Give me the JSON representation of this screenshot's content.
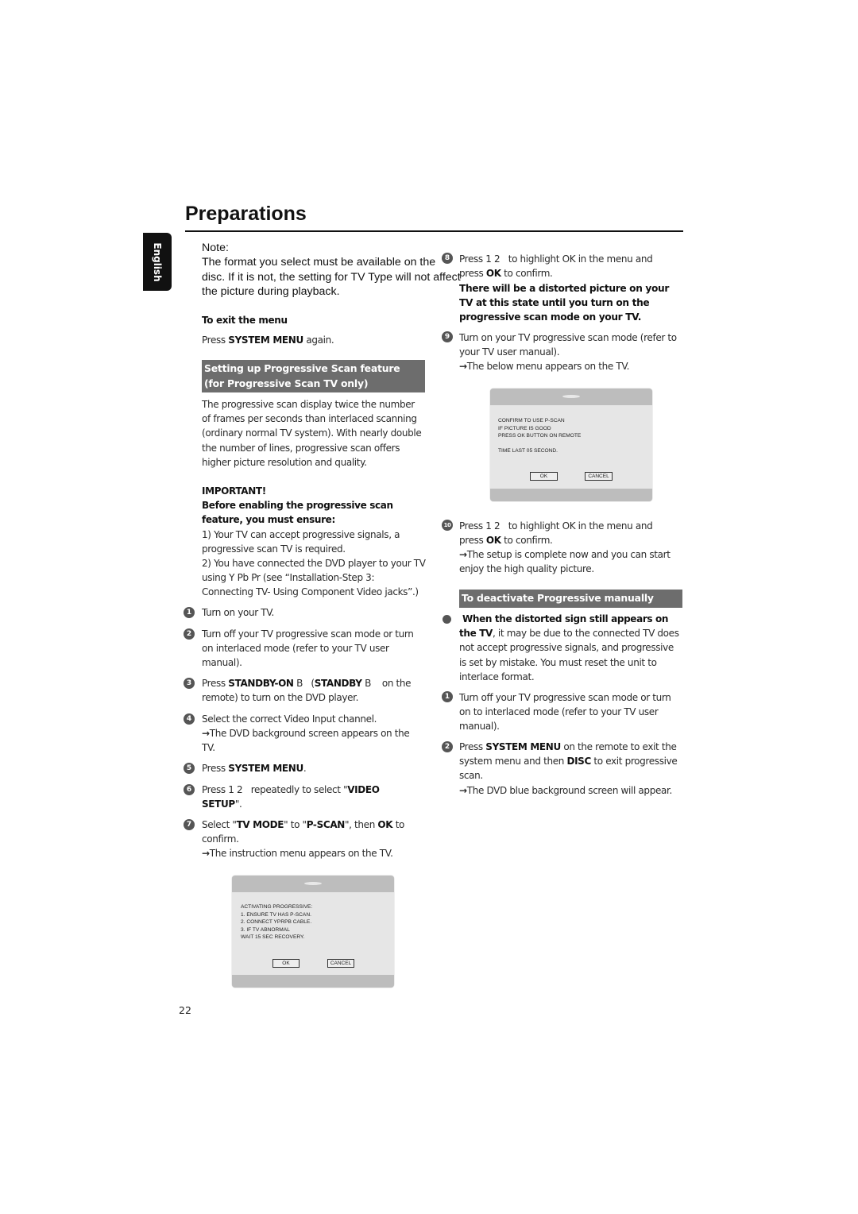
{
  "title": "Preparations",
  "language_tab": "English",
  "note": {
    "label": "Note:",
    "lines": [
      "The format you select must be available on the",
      "disc. If it is not, the setting for TV Type will not affect",
      "the picture during playback."
    ]
  },
  "exit_menu": {
    "heading": "To exit the menu",
    "body": [
      {
        "t": "Press "
      },
      {
        "t": "SYSTEM MENU",
        "b": true
      },
      {
        "t": " again."
      }
    ]
  },
  "section1_heading": "Setting up Progressive Scan feature (for Progressive Scan TV only)",
  "intro": "The progressive scan display twice the number of frames per seconds than interlaced scanning (ordinary normal TV system). With nearly double the number of lines, progressive scan offers higher picture resolution and quality.",
  "important": {
    "heading": "IMPORTANT!",
    "subheading": "Before enabling the progressive scan feature, you must ensure:",
    "items": [
      "1) Your TV can accept progressive signals, a progressive scan TV is required.",
      "2) You have connected the DVD player to your TV using Y Pb Pr (see “Installation-Step 3: Connecting TV- Using Component Video jacks”.)"
    ]
  },
  "left_steps": [
    {
      "num": "1",
      "segs": [
        {
          "t": "Turn on your TV."
        }
      ]
    },
    {
      "num": "2",
      "segs": [
        {
          "t": "Turn off your TV progressive scan mode or turn on interlaced mode (refer to your TV user manual)."
        }
      ]
    },
    {
      "num": "3",
      "segs": [
        {
          "t": "Press "
        },
        {
          "t": "STANDBY-ON",
          "b": true
        },
        {
          "t": " B   ("
        },
        {
          "t": "STANDBY",
          "b": true
        },
        {
          "t": " B    on the remote) to turn on the DVD player."
        }
      ]
    },
    {
      "num": "4",
      "segs": [
        {
          "t": "Select the correct Video Input channel."
        }
      ],
      "result": "The DVD background screen appears on the TV."
    },
    {
      "num": "5",
      "segs": [
        {
          "t": "Press "
        },
        {
          "t": "SYSTEM MENU",
          "b": true
        },
        {
          "t": "."
        }
      ]
    },
    {
      "num": "6",
      "segs": [
        {
          "t": "Press 1 2   repeatedly to select \""
        },
        {
          "t": "VIDEO SETUP",
          "b": true
        },
        {
          "t": "\"."
        }
      ]
    },
    {
      "num": "7",
      "segs": [
        {
          "t": "Select \""
        },
        {
          "t": "TV MODE",
          "b": true
        },
        {
          "t": "\" to \""
        },
        {
          "t": "P-SCAN",
          "b": true
        },
        {
          "t": "\", then "
        },
        {
          "t": "OK",
          "b": true
        },
        {
          "t": " to confirm."
        }
      ],
      "result": "The instruction menu appears on the TV."
    }
  ],
  "tv_menu_1": {
    "lines": [
      "ACTIVATING PROGRESSIVE:",
      "1. ENSURE TV HAS P-SCAN.",
      "2. CONNECT YPRPB CABLE.",
      "3. IF TV ABNORMAL",
      "WAIT 15 SEC RECOVERY."
    ],
    "ok": "OK",
    "cancel": "CANCEL"
  },
  "page_number": "22",
  "right_steps": [
    {
      "num": "8",
      "segs": [
        {
          "t": "Press "
        },
        {
          "t": "1 2",
          "b": false
        },
        {
          "t": "   to highlight OK in the menu and press "
        },
        {
          "t": "OK",
          "b": true
        },
        {
          "t": " to confirm."
        }
      ],
      "warning": "There will be a distorted picture on your TV at this state until you turn on the progressive scan mode on your TV."
    },
    {
      "num": "9",
      "segs": [
        {
          "t": "Turn on your TV progressive scan mode (refer to your TV user manual)."
        }
      ],
      "result": "The below menu appears on the TV."
    },
    {
      "num": "10",
      "segs": [
        {
          "t": "Press 1 2   to highlight OK in the menu and press "
        },
        {
          "t": "OK",
          "b": true
        },
        {
          "t": " to confirm."
        }
      ],
      "result": "The setup is complete now and you can start enjoy the high quality picture."
    }
  ],
  "tv_menu_2": {
    "lines": [
      "CONFIRM TO USE P-SCAN",
      "IF PICTURE IS GOOD",
      "PRESS OK BUTTON ON REMOTE",
      "",
      "TIME LAST 05 SECOND."
    ],
    "ok": "OK",
    "cancel": "CANCEL"
  },
  "section2_heading": "To deactivate Progressive manually",
  "bullet": [
    {
      "t": "When the distorted sign still appears on the TV",
      "b": true
    },
    {
      "t": ", it may be due to the connected TV does not accept progressive signals, and progressive is set by mistake. You must reset the unit to interlace format."
    }
  ],
  "deactivate_steps": [
    {
      "num": "1",
      "segs": [
        {
          "t": "Turn off your TV progressive scan mode or turn on to interlaced mode (refer to your TV user manual)."
        }
      ]
    },
    {
      "num": "2",
      "segs": [
        {
          "t": "Press "
        },
        {
          "t": "SYSTEM MENU",
          "b": true
        },
        {
          "t": " on the remote to exit the system menu and then "
        },
        {
          "t": "DISC",
          "b": true
        },
        {
          "t": " to exit progressive scan."
        }
      ],
      "result": "The DVD blue background screen will appear."
    }
  ],
  "colors": {
    "heading_box": "#6d6d6d",
    "text": "#2a2a2a",
    "step_circle": "#555555",
    "tv_screen": "#e6e6e6",
    "tv_bar": "#bdbdbd"
  }
}
